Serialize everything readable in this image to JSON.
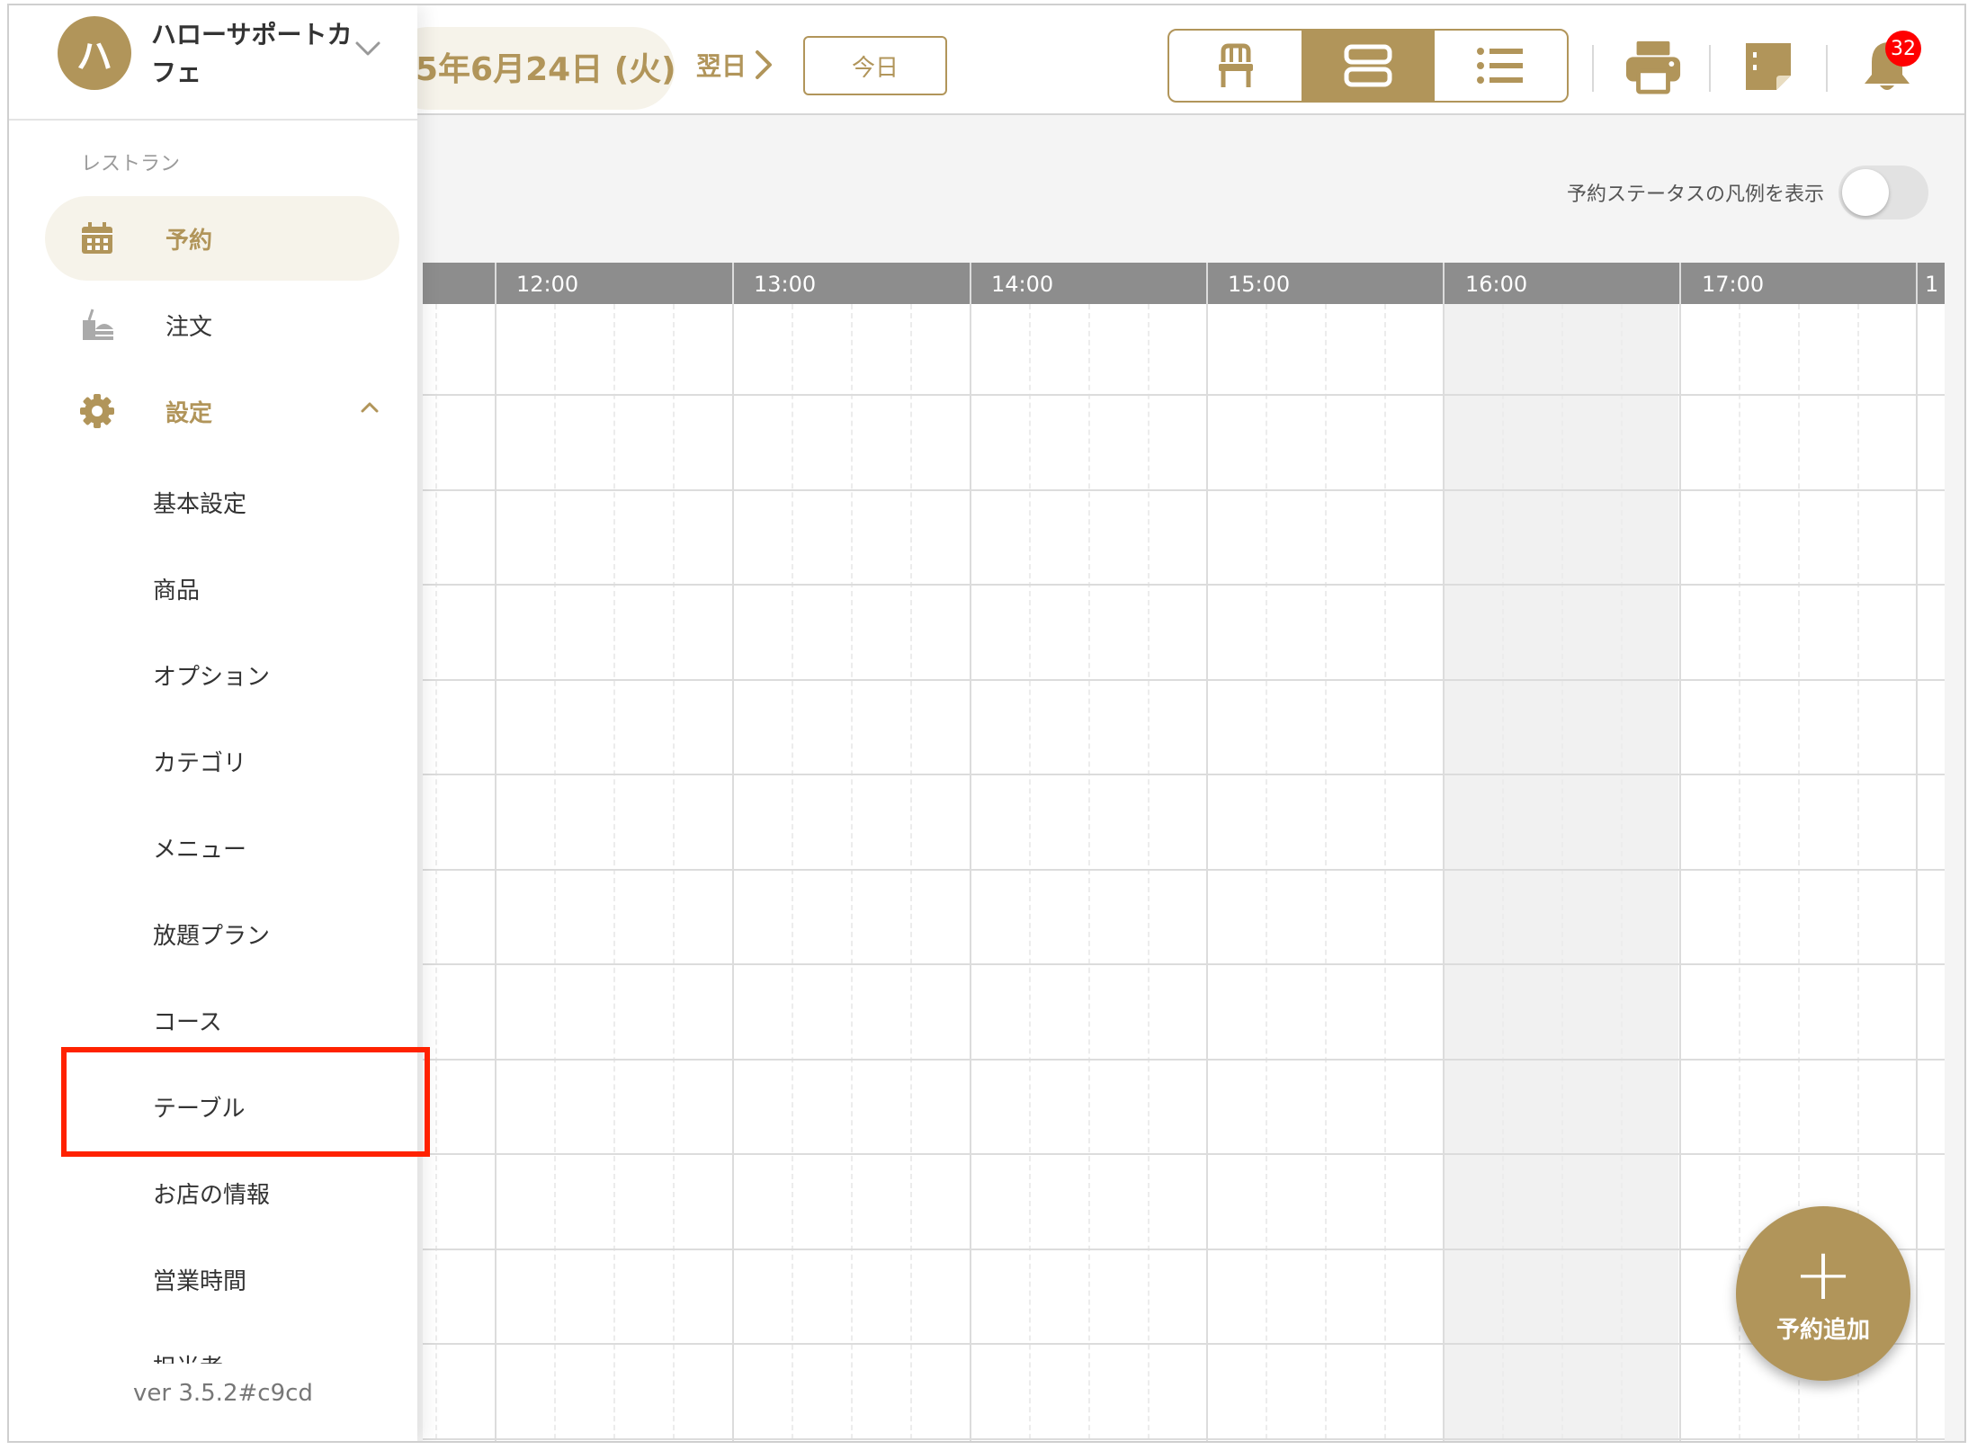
{
  "header": {
    "date_label": "5年6月24日 (火)",
    "next_day_label": "翌日",
    "today_label": "今日",
    "view_modes": [
      "seat-view",
      "timeline-view",
      "list-view"
    ],
    "active_view": "timeline-view",
    "notification_count": "32"
  },
  "legend_toggle": {
    "label": "予約ステータスの凡例を表示",
    "on": false
  },
  "timeline": {
    "time_labels": [
      "12:00",
      "13:00",
      "14:00",
      "15:00",
      "16:00",
      "17:00",
      "1"
    ],
    "shaded_hour": "16:00"
  },
  "fab": {
    "label": "予約追加",
    "icon": "plus-icon"
  },
  "sidebar": {
    "shop_initial": "ハ",
    "shop_name": "ハローサポートカフェ",
    "section_label": "レストラン",
    "nav": [
      {
        "label": "予約",
        "icon": "calendar-icon",
        "active": true
      },
      {
        "label": "注文",
        "icon": "food-tray-icon",
        "active": false
      },
      {
        "label": "設定",
        "icon": "gear-icon",
        "active": false,
        "expanded": true
      }
    ],
    "settings_items": [
      "基本設定",
      "商品",
      "オプション",
      "カテゴリ",
      "メニュー",
      "放題プラン",
      "コース",
      "テーブル",
      "お店の情報",
      "営業時間",
      "担当者"
    ],
    "highlighted_item": "テーブル",
    "version": "ver 3.5.2#c9cd"
  },
  "colors": {
    "accent": "#b1955a",
    "highlight": "#ff2200",
    "badge": "#ff0000",
    "time_header": "#8d8d8d"
  }
}
